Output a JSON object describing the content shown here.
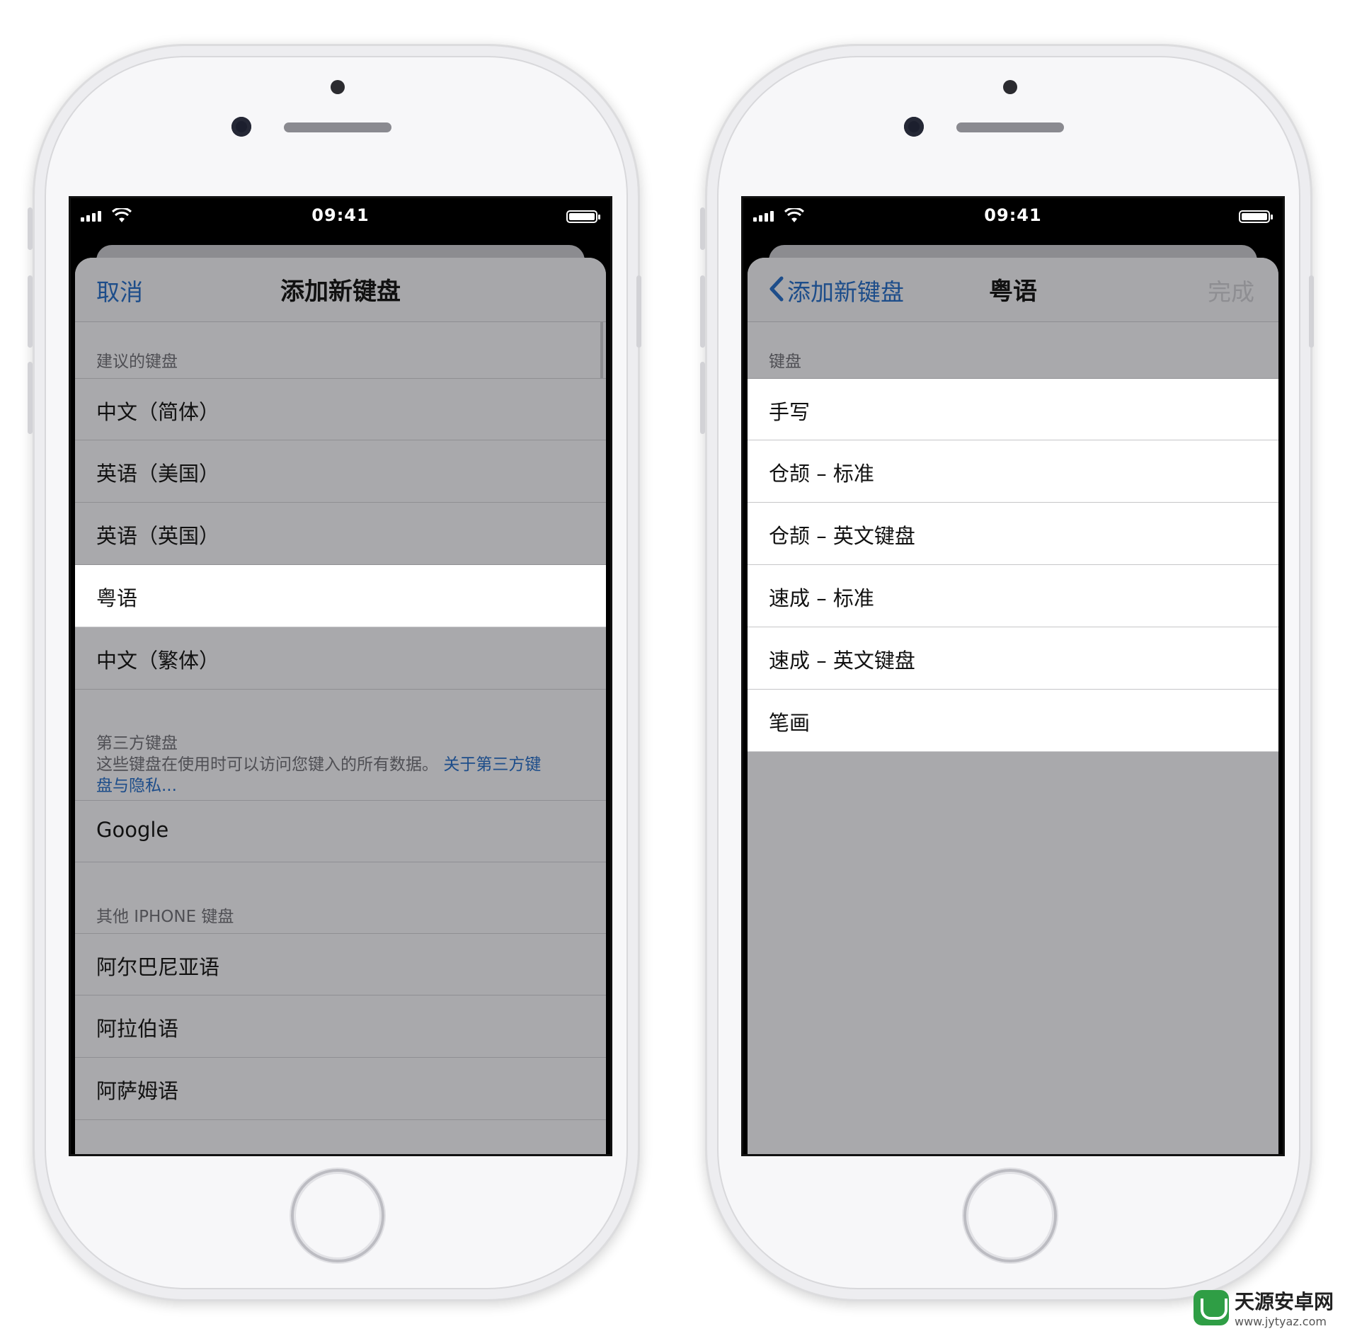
{
  "status_bar": {
    "time": "09:41"
  },
  "left_screen": {
    "nav": {
      "cancel": "取消",
      "title": "添加新键盘"
    },
    "suggested": {
      "header": "建议的键盘",
      "items": [
        "中文（简体）",
        "英语（美国）",
        "英语（英国）",
        "粤语",
        "中文（繁体）"
      ],
      "selected": "粤语"
    },
    "third_party": {
      "header": "第三方键盘",
      "description": "这些键盘在使用时可以访问您键入的所有数据。",
      "link_line1": "关于第三方键",
      "link_line2": "盘与隐私...",
      "items": [
        "Google"
      ]
    },
    "other": {
      "header": "其他 IPHONE 键盘",
      "items": [
        "阿尔巴尼亚语",
        "阿拉伯语",
        "阿萨姆语"
      ]
    }
  },
  "right_screen": {
    "nav": {
      "back": "添加新键盘",
      "title": "粤语",
      "done": "完成"
    },
    "keyboards": {
      "header": "键盘",
      "items": [
        "手写",
        "仓颉 – 标准",
        "仓颉 – 英文键盘",
        "速成 – 标准",
        "速成 – 英文键盘",
        "笔画"
      ]
    }
  },
  "watermark": {
    "title": "天源安卓网",
    "url": "www.jytyaz.com"
  },
  "colors": {
    "accent": "#1d4d8a",
    "dim_background": "#a9a9ac",
    "selected_row": "#ffffff"
  }
}
